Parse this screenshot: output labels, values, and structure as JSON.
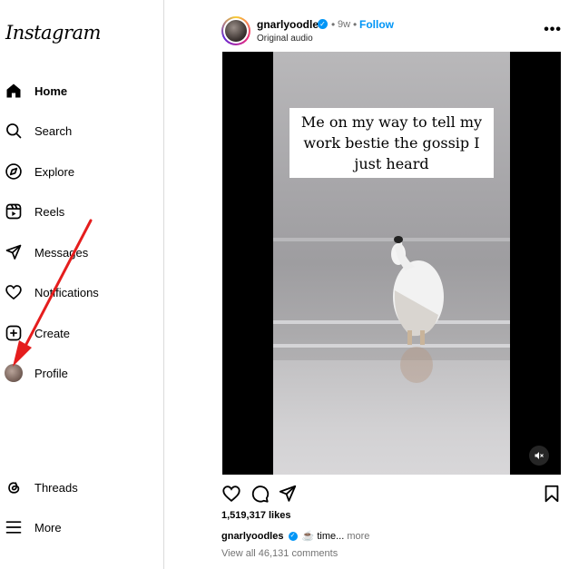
{
  "app": {
    "logo_text": "Instagram"
  },
  "sidebar": {
    "items": [
      {
        "label": "Home",
        "icon": "home-icon",
        "active": true
      },
      {
        "label": "Search",
        "icon": "search-icon"
      },
      {
        "label": "Explore",
        "icon": "compass-icon"
      },
      {
        "label": "Reels",
        "icon": "reels-icon"
      },
      {
        "label": "Messages",
        "icon": "send-icon"
      },
      {
        "label": "Notifications",
        "icon": "heart-icon"
      },
      {
        "label": "Create",
        "icon": "plus-square-icon"
      },
      {
        "label": "Profile",
        "icon": "avatar"
      }
    ],
    "bottom": [
      {
        "label": "Threads",
        "icon": "threads-icon"
      },
      {
        "label": "More",
        "icon": "menu-icon"
      }
    ]
  },
  "post": {
    "username": "gnarlyoodles",
    "verified_glyph": "✓",
    "time": "9w",
    "separator": "•",
    "follow_label": "Follow",
    "audio": "Original audio",
    "more_glyph": "•••",
    "video_caption": "Me on my way to tell my work bestie the gossip I just heard",
    "likes": "1,519,317 likes",
    "caption_user": "gnarlyoodles",
    "caption_text": "☕ time...",
    "caption_more": "more",
    "comments_link": "View all 46,131 comments"
  },
  "colors": {
    "accent": "#0095f6",
    "annotation_arrow": "#e51d1d",
    "divider": "#dbdbdb"
  }
}
